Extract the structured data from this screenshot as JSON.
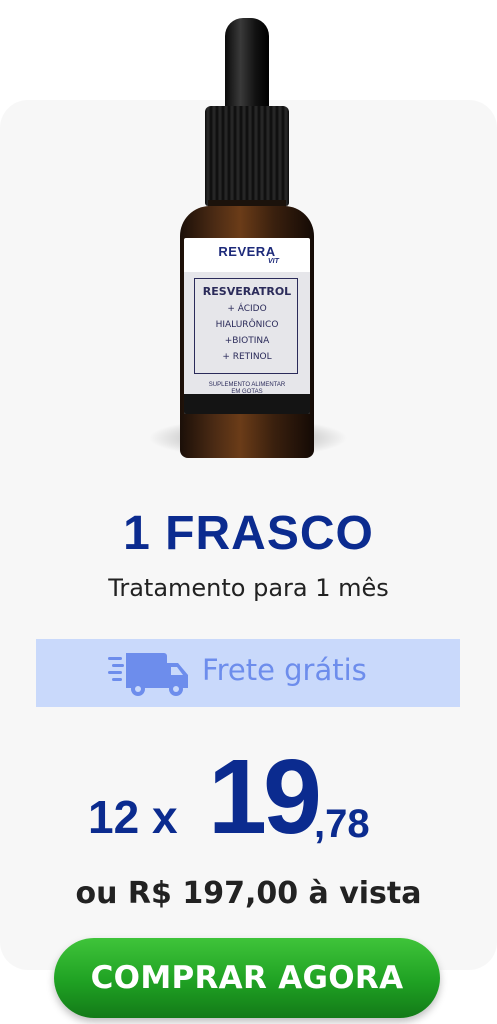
{
  "product": {
    "label": {
      "brand": "REVERA",
      "brand_sub": "VIT",
      "lines": [
        "RESVERATROL",
        "+ ÁCIDO",
        "HIALURÔNICO",
        "+BIOTINA",
        "+ RETINOL"
      ],
      "footer_1": "SUPLEMENTO ALIMENTAR",
      "footer_2": "EM GOTAS"
    },
    "title": "1 FRASCO",
    "subtitle": "Tratamento para 1 mês"
  },
  "shipping": {
    "label": "Frete grátis",
    "icon": "truck-icon"
  },
  "price": {
    "installments": "12 x",
    "integer": "19",
    "cents": ",78",
    "cash": "ou R$ 197,00 à vista"
  },
  "cta": {
    "label": "COMPRAR AGORA"
  },
  "colors": {
    "primary": "#0b2b8f",
    "banner": "#c9d9fb",
    "banner_text": "#6d8dec",
    "button": "#1fa123"
  }
}
